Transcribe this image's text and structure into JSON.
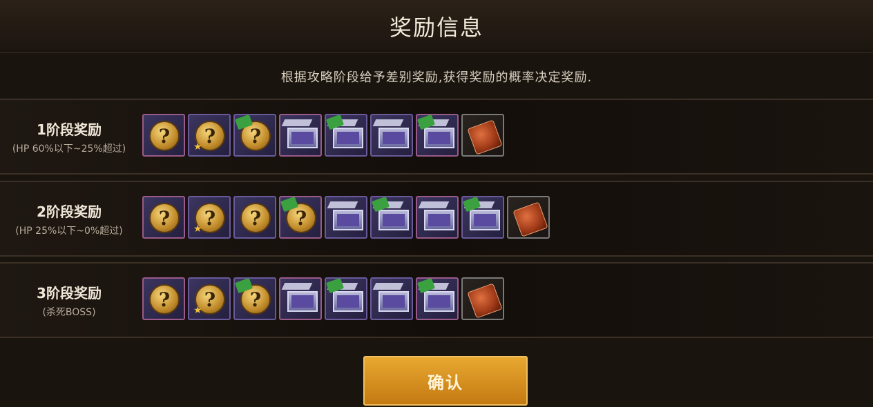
{
  "title": "奖励信息",
  "subtitle": "根据攻略阶段给予差别奖励,获得奖励的概率决定奖励.",
  "stages": [
    {
      "title": "1阶段奖励",
      "condition": "(HP 60%以下~25%超过)",
      "items": [
        "coin",
        "coin-star",
        "coin-tag",
        "box",
        "box-tag",
        "box",
        "box-tag",
        "chest"
      ]
    },
    {
      "title": "2阶段奖励",
      "condition": "(HP 25%以下~0%超过)",
      "items": [
        "coin",
        "coin-star",
        "coin",
        "coin-tag",
        "box",
        "box-tag",
        "box",
        "box-tag",
        "chest"
      ]
    },
    {
      "title": "3阶段奖励",
      "condition": "(杀死BOSS)",
      "items": [
        "coin",
        "coin-star",
        "coin-tag",
        "box",
        "box-tag",
        "box",
        "box-tag",
        "chest"
      ]
    }
  ],
  "confirm_label": "确认"
}
